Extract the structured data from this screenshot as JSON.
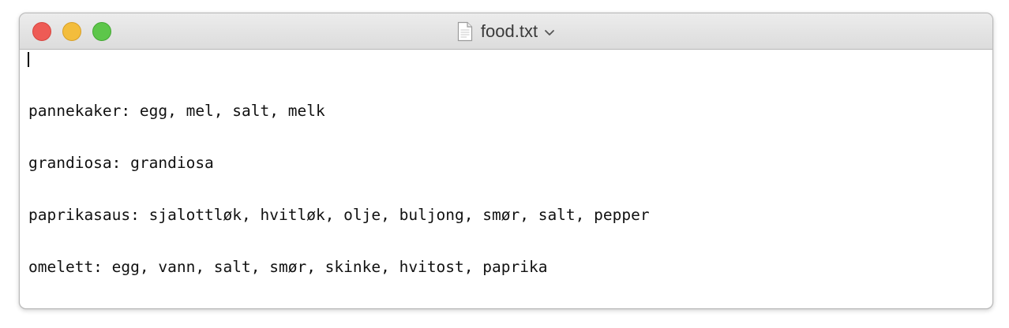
{
  "window": {
    "title": "food.txt",
    "title_icon": "document-icon",
    "title_menu_icon": "chevron-down-icon",
    "traffic_lights": {
      "close_color": "#ee5b55",
      "minimize_color": "#f3bd3c",
      "zoom_color": "#5dc64a"
    }
  },
  "editor": {
    "lines": [
      "pannekaker: egg, mel, salt, melk",
      "grandiosa: grandiosa",
      "paprikasaus: sjalottløk, hvitløk, olje, buljong, smør, salt, pepper",
      "omelett: egg, vann, salt, smør, skinke, hvitost, paprika"
    ]
  }
}
